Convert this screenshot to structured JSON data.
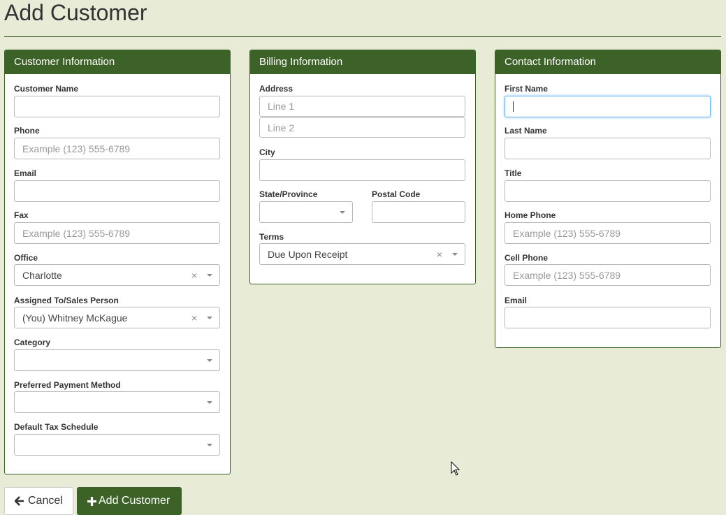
{
  "page": {
    "title": "Add Customer"
  },
  "customer_info": {
    "header": "Customer Information",
    "customer_name_label": "Customer Name",
    "phone_label": "Phone",
    "phone_placeholder": "Example (123) 555-6789",
    "email_label": "Email",
    "fax_label": "Fax",
    "fax_placeholder": "Example (123) 555-6789",
    "office_label": "Office",
    "office_value": "Charlotte",
    "assigned_label": "Assigned To/Sales Person",
    "assigned_value": "(You) Whitney McKague",
    "category_label": "Category",
    "payment_label": "Preferred Payment Method",
    "tax_label": "Default Tax Schedule"
  },
  "billing_info": {
    "header": "Billing Information",
    "address_label": "Address",
    "line1_placeholder": "Line 1",
    "line2_placeholder": "Line 2",
    "city_label": "City",
    "state_label": "State/Province",
    "postal_label": "Postal Code",
    "terms_label": "Terms",
    "terms_value": "Due Upon Receipt"
  },
  "contact_info": {
    "header": "Contact Information",
    "first_name_label": "First Name",
    "last_name_label": "Last Name",
    "title_label": "Title",
    "home_phone_label": "Home Phone",
    "home_phone_placeholder": "Example (123) 555-6789",
    "cell_phone_label": "Cell Phone",
    "cell_phone_placeholder": "Example (123) 555-6789",
    "email_label": "Email"
  },
  "actions": {
    "cancel_label": "Cancel",
    "add_label": "Add Customer"
  },
  "select_clear_glyph": "×",
  "colors": {
    "brand": "#3d6228",
    "background": "#e8ecd6",
    "focus": "#66afe9"
  }
}
